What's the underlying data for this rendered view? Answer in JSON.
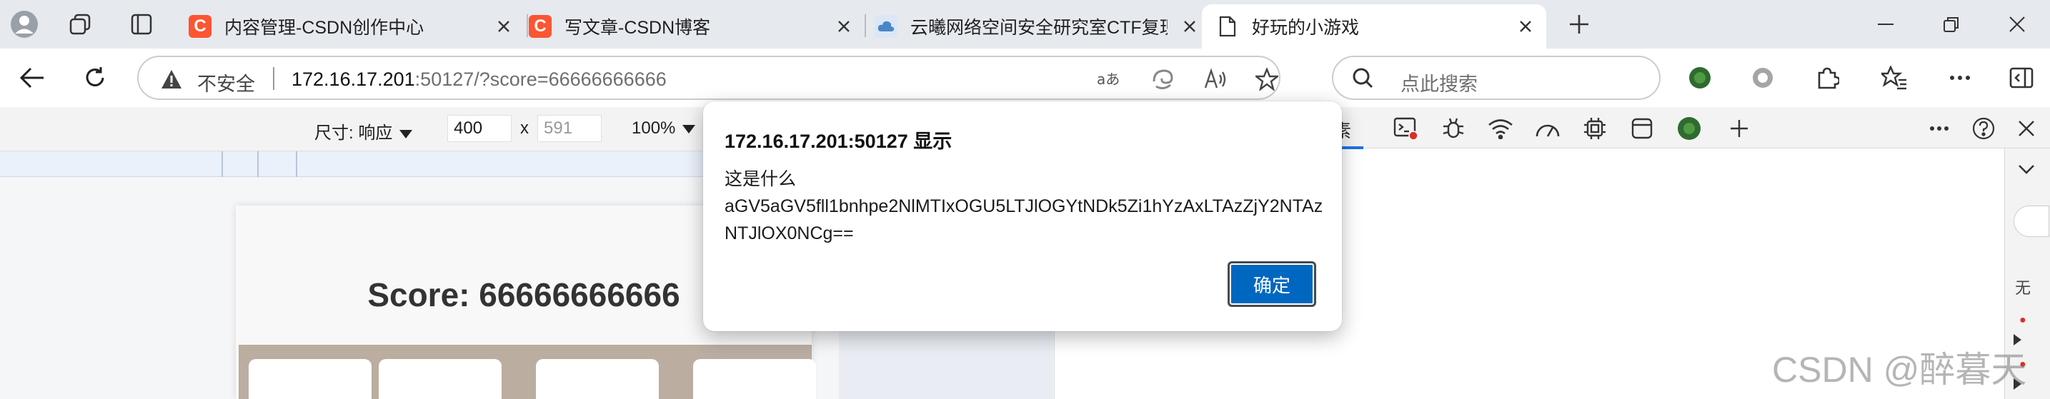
{
  "tabs": [
    {
      "title": "内容管理-CSDN创作中心",
      "favicon": "csdn-icon"
    },
    {
      "title": "写文章-CSDN博客",
      "favicon": "csdn-icon"
    },
    {
      "title": "云曦网络空间安全研究室CTF复现",
      "favicon": "cloud-icon"
    },
    {
      "title": "好玩的小游戏",
      "favicon": "page-icon",
      "active": true
    }
  ],
  "address_bar": {
    "security_label": "不安全",
    "url_host": "172.16.17.201",
    "url_rest": ":50127/?score=66666666666"
  },
  "search": {
    "placeholder": "点此搜索"
  },
  "device_toolbar": {
    "dimensions_label": "尺寸: 响应",
    "width": "400",
    "separator": "x",
    "height": "591",
    "zoom": "100%"
  },
  "game": {
    "score_text": "Score: 66666666666"
  },
  "devtools": {
    "elements_tab_label": "素",
    "side_text": "无"
  },
  "dialog": {
    "title": "172.16.17.201:50127 显示",
    "message_line1": "这是什么",
    "message_line2": "aGV5aGV5fll1bnhpe2NlMTIxOGU5LTJlOGYtNDk5Zi1hYzAxLTAzZjY2NTAz",
    "message_line3": "NTJlOX0NCg==",
    "ok_label": "确定"
  },
  "watermark": "CSDN @醉暮天",
  "colors": {
    "csdn": "#fc5531",
    "accent": "#0067c0",
    "board": "#bbada0"
  }
}
